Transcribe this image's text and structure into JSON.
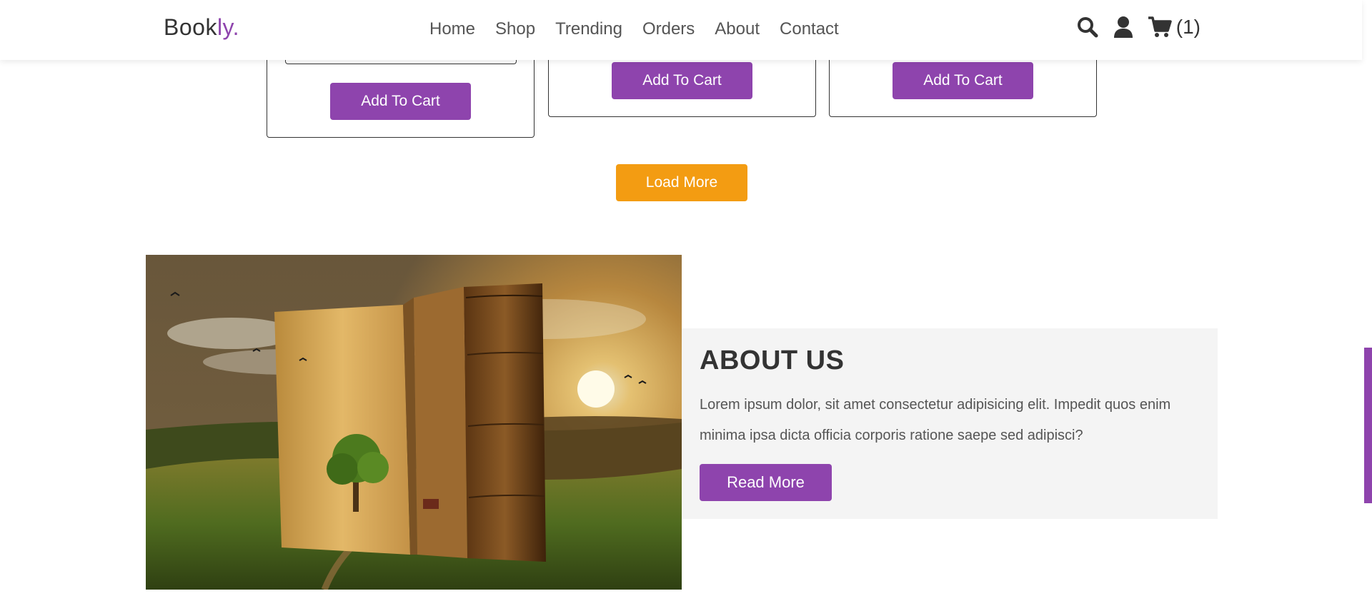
{
  "header": {
    "logo_main": "Book",
    "logo_accent": "ly.",
    "nav": [
      "Home",
      "Shop",
      "Trending",
      "Orders",
      "About",
      "Contact"
    ],
    "cart_count": "(1)"
  },
  "products": {
    "add_to_cart_label": "Add To Cart"
  },
  "load_more_label": "Load More",
  "about": {
    "title": "ABOUT US",
    "text": "Lorem ipsum dolor, sit amet consectetur adipisicing elit. Impedit quos enim minima ipsa dicta officia corporis ratione saepe sed adipisci?",
    "button_label": "Read More"
  },
  "colors": {
    "accent": "#8e44ad",
    "load_more": "#f39c12",
    "panel_bg": "#f4f4f4"
  },
  "icons": [
    "search-icon",
    "user-icon",
    "cart-icon"
  ]
}
